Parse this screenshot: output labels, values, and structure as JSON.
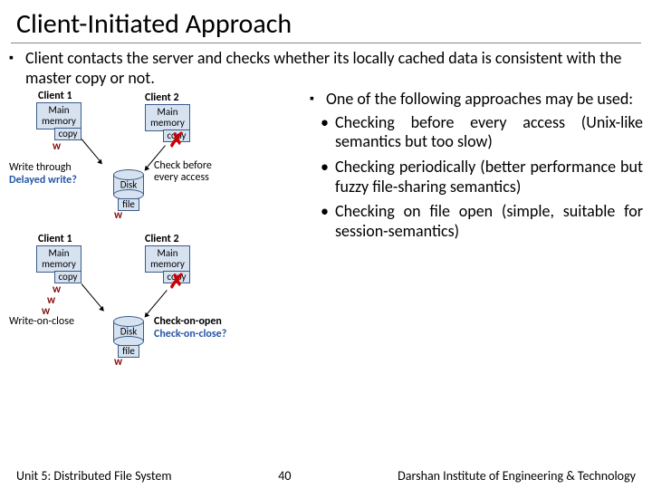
{
  "title": "Client-Initiated Approach",
  "intro": "Client contacts the server and checks whether its locally cached data is consistent with the master copy or not.",
  "sub": "One of the following approaches may be used:",
  "bullets": [
    "Checking before every access (Unix-like semantics but too slow)",
    "Checking periodically (better performance but fuzzy file-sharing semantics)",
    "Checking on file open (simple, suitable for session-semantics)"
  ],
  "diagram": {
    "client1": "Client 1",
    "client2": "Client 2",
    "mainmem": "Main\nmemory",
    "copy": "copy",
    "disk": "Disk",
    "file": "file",
    "W": "W",
    "writeThrough": "Write through",
    "delayedWrite": "Delayed write?",
    "checkBefore": "Check before\nevery access",
    "writeOnClose": "Write-on-close",
    "checkOnOpen": "Check-on-open",
    "checkOnClose": "Check-on-close?"
  },
  "footer": {
    "left": "Unit 5: Distributed File System",
    "center": "40",
    "right": "Darshan Institute of Engineering & Technology"
  }
}
